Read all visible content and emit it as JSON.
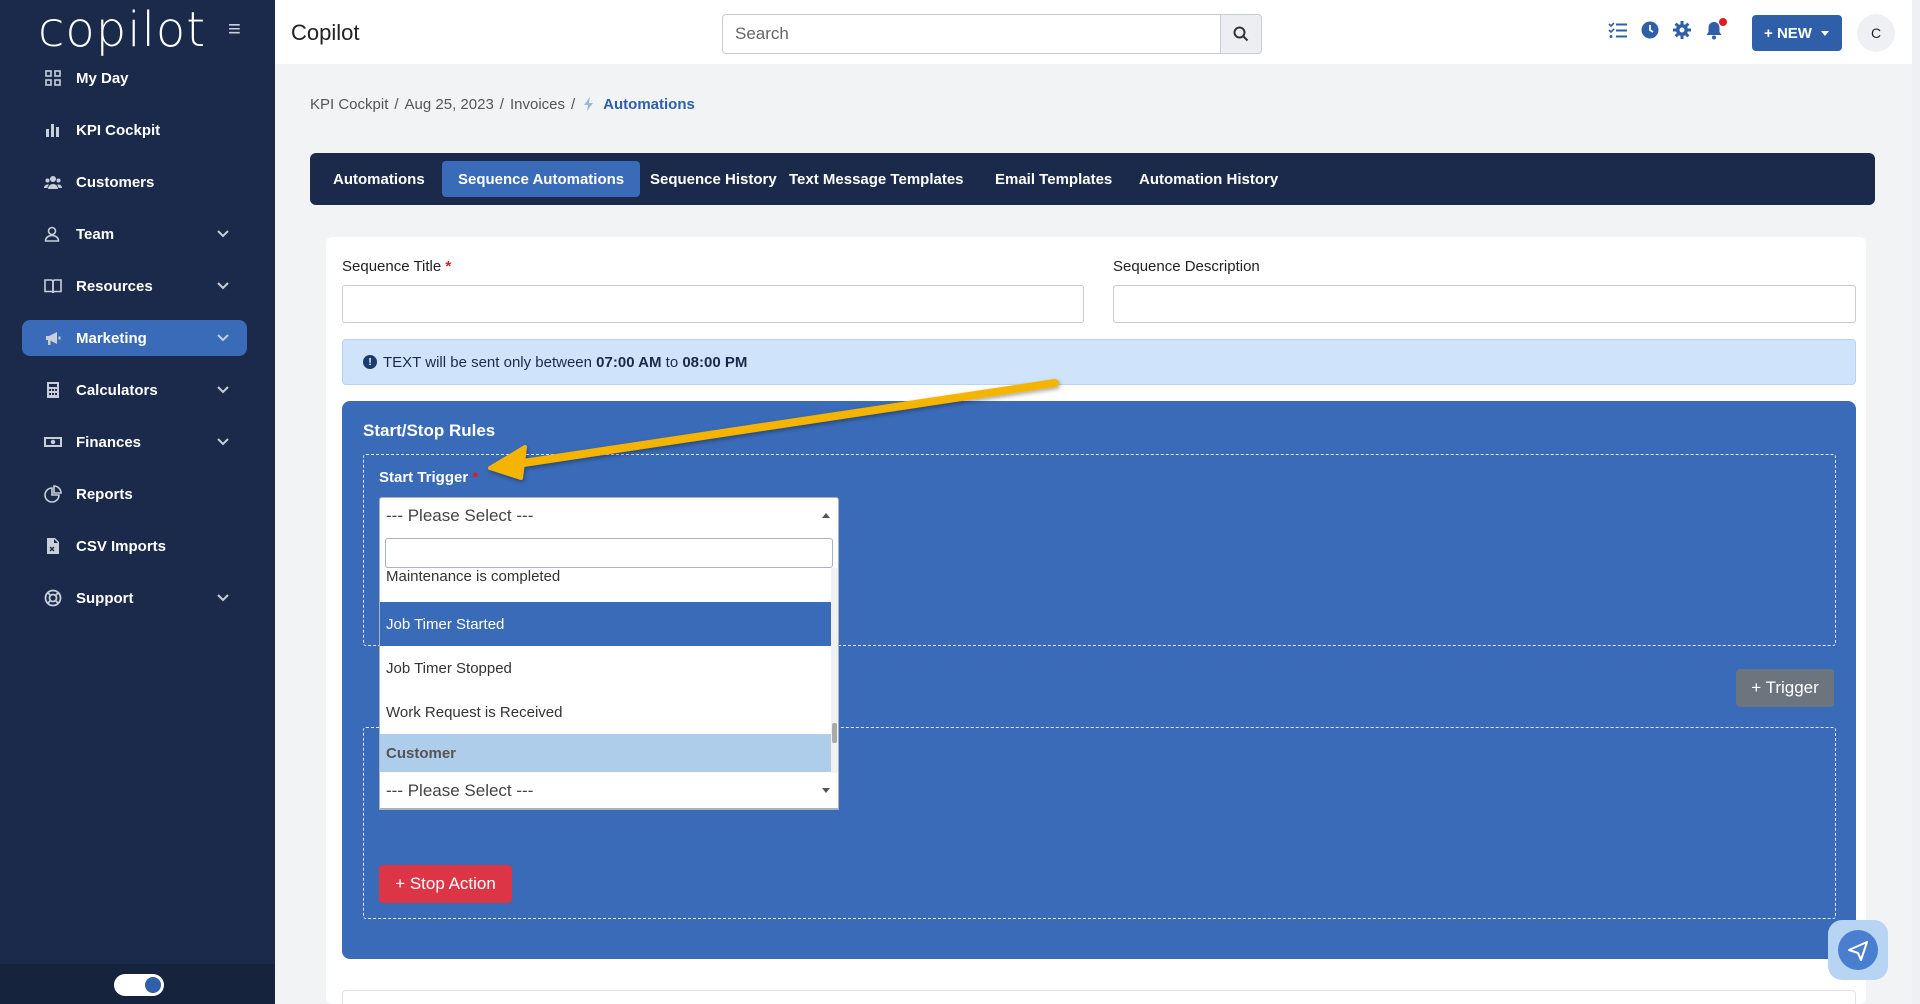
{
  "sidebar": {
    "logo": "copilot",
    "items": [
      {
        "label": "My Day",
        "icon": "grid-icon",
        "expandable": false
      },
      {
        "label": "KPI Cockpit",
        "icon": "bar-chart-icon",
        "expandable": false
      },
      {
        "label": "Customers",
        "icon": "users-icon",
        "expandable": false
      },
      {
        "label": "Team",
        "icon": "user-icon",
        "expandable": true
      },
      {
        "label": "Resources",
        "icon": "book-icon",
        "expandable": true
      },
      {
        "label": "Marketing",
        "icon": "megaphone-icon",
        "expandable": true,
        "active": true
      },
      {
        "label": "Calculators",
        "icon": "calculator-icon",
        "expandable": true
      },
      {
        "label": "Finances",
        "icon": "money-icon",
        "expandable": true
      },
      {
        "label": "Reports",
        "icon": "pie-chart-icon",
        "expandable": false
      },
      {
        "label": "CSV Imports",
        "icon": "file-csv-icon",
        "expandable": false
      },
      {
        "label": "Support",
        "icon": "lifebuoy-icon",
        "expandable": true
      }
    ]
  },
  "header": {
    "title": "Copilot",
    "search_placeholder": "Search",
    "new_label": "+ NEW",
    "avatar_initial": "C"
  },
  "breadcrumb": {
    "items": [
      "KPI Cockpit",
      "Aug 25, 2023",
      "Invoices"
    ],
    "separator": "/",
    "current": "Automations"
  },
  "tabs": [
    {
      "label": "Automations",
      "active": false
    },
    {
      "label": "Sequence Automations",
      "active": true
    },
    {
      "label": "Sequence History",
      "active": false
    },
    {
      "label": "Text Message Templates",
      "active": false
    },
    {
      "label": "Email Templates",
      "active": false
    },
    {
      "label": "Automation History",
      "active": false
    }
  ],
  "form": {
    "title_label": "Sequence Title",
    "description_label": "Sequence Description",
    "info_prefix": "TEXT will be sent only between",
    "info_start": "07:00 AM",
    "info_to": "to",
    "info_end": "08:00 PM"
  },
  "rules": {
    "title": "Start/Stop Rules",
    "start_trigger_label": "Start Trigger",
    "select_placeholder": "--- Please Select ---",
    "options": [
      {
        "label": "Maintenance is completed",
        "state": "partial"
      },
      {
        "label": "Job Timer Started",
        "state": "highlighted"
      },
      {
        "label": "Job Timer Stopped",
        "state": "normal"
      },
      {
        "label": "Work Request is Received",
        "state": "normal"
      },
      {
        "label": "Customer",
        "state": "group"
      }
    ],
    "second_select_placeholder": "--- Please Select ---",
    "trigger_button": "+ Trigger",
    "stop_action_button": "+ Stop Action"
  },
  "colors": {
    "sidebar_bg": "#1b2a4a",
    "accent": "#3a6bb8",
    "danger": "#dc3545",
    "info_bg": "#cfe4fb",
    "annotation_arrow": "#f5b400"
  }
}
